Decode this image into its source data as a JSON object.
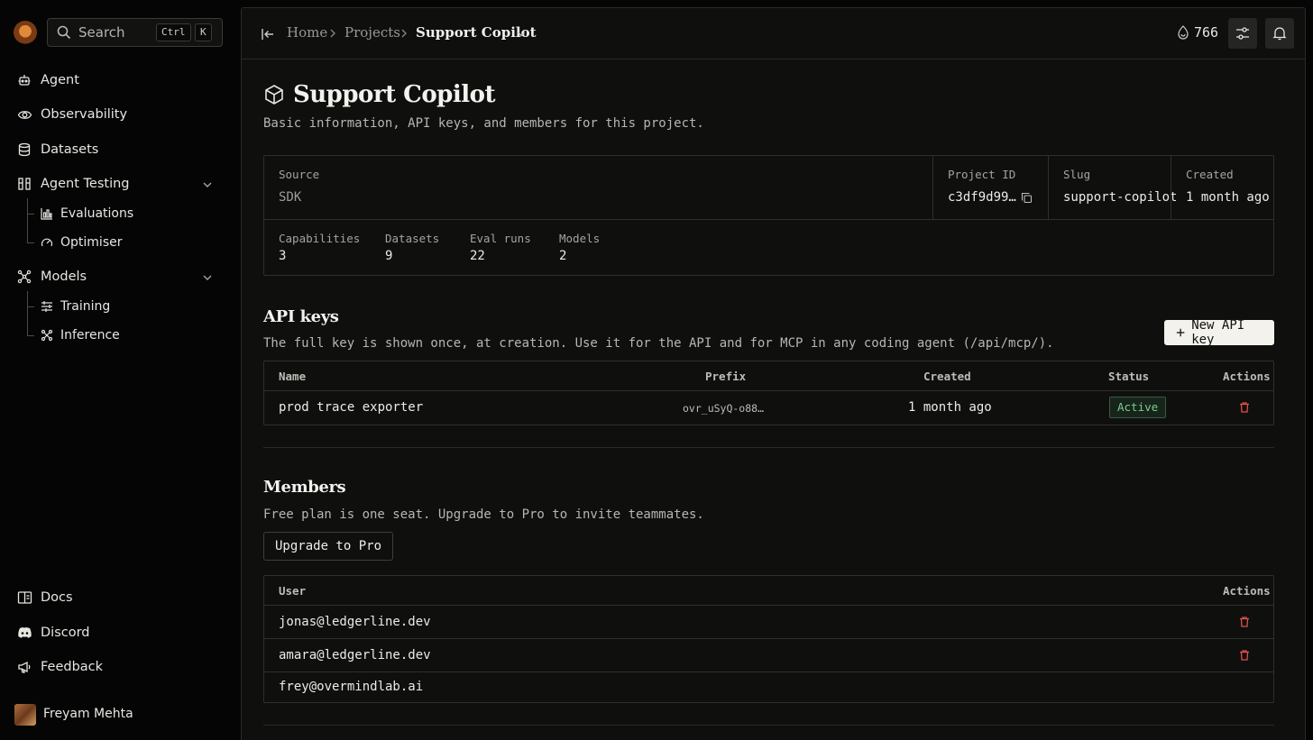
{
  "sidebar": {
    "search": {
      "label": "Search",
      "kbd1": "Ctrl",
      "kbd2": "K"
    },
    "nav": {
      "agent": "Agent",
      "observability": "Observability",
      "datasets": "Datasets",
      "agent_testing": "Agent Testing",
      "evaluations": "Evaluations",
      "optimiser": "Optimiser",
      "models": "Models",
      "training": "Training",
      "inference": "Inference"
    },
    "footer": {
      "docs": "Docs",
      "discord": "Discord",
      "feedback": "Feedback"
    },
    "user": {
      "name": "Freyam Mehta"
    }
  },
  "topbar": {
    "breadcrumb": {
      "home": "Home",
      "projects": "Projects",
      "current": "Support Copilot"
    },
    "credits": "766"
  },
  "project": {
    "title": "Support Copilot",
    "subtitle": "Basic information, API keys, and members for this project.",
    "info": {
      "source_label": "Source",
      "source_value": "SDK",
      "id_label": "Project ID",
      "id_value": "c3df9d99…",
      "slug_label": "Slug",
      "slug_value": "support-copilot",
      "created_label": "Created",
      "created_value": "1 month ago"
    },
    "stats": {
      "capabilities_label": "Capabilities",
      "capabilities": "3",
      "datasets_label": "Datasets",
      "datasets": "9",
      "evalruns_label": "Eval runs",
      "evalruns": "22",
      "models_label": "Models",
      "models": "2"
    }
  },
  "api_keys": {
    "title": "API keys",
    "description": "The full key is shown once, at creation. Use it for the API and for MCP in any coding agent (/api/mcp/).",
    "new_button": "New API key",
    "columns": {
      "name": "Name",
      "prefix": "Prefix",
      "created": "Created",
      "status": "Status",
      "actions": "Actions"
    },
    "rows": [
      {
        "name": "prod trace exporter",
        "prefix": "ovr_uSyQ-o88…",
        "created": "1 month ago",
        "status": "Active"
      }
    ]
  },
  "members": {
    "title": "Members",
    "description": "Free plan is one seat. Upgrade to Pro to invite teammates.",
    "upgrade_button": "Upgrade to Pro",
    "columns": {
      "user": "User",
      "actions": "Actions"
    },
    "rows": [
      {
        "email": "jonas@ledgerline.dev"
      },
      {
        "email": "amara@ledgerline.dev"
      },
      {
        "email": "frey@overmindlab.ai"
      }
    ]
  },
  "colors": {
    "accent_status": "#7ecb8f",
    "danger": "#e0504a",
    "background": "#0f0f0e"
  }
}
